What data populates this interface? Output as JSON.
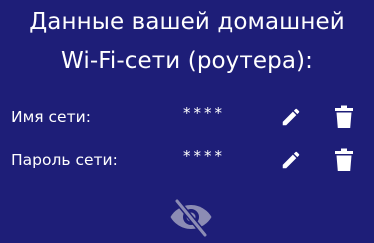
{
  "header": {
    "line1": "Данные вашей домашней",
    "line2": "Wi-Fi-сети (роутера):"
  },
  "fields": [
    {
      "label": "Имя сети:",
      "value": "****",
      "edit_icon": "pencil-icon",
      "delete_icon": "trash-icon"
    },
    {
      "label": "Пароль сети:",
      "value": "****",
      "edit_icon": "pencil-icon",
      "delete_icon": "trash-icon"
    }
  ],
  "visibility_toggle": {
    "icon": "eye-off-icon",
    "icon_color": "#8c8cb4"
  },
  "colors": {
    "background": "#1e1e78",
    "text": "#ffffff"
  }
}
